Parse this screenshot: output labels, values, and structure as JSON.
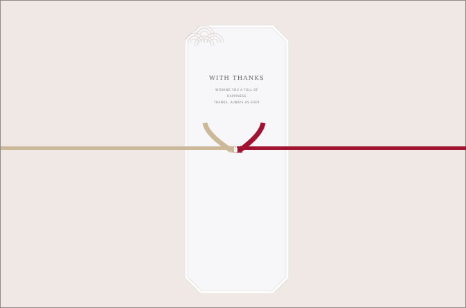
{
  "card": {
    "title": "WITH THANKS",
    "message_lines": [
      "WISHING YOU A FULL OF",
      "HAPPINESS",
      "THANKS, ALWAYS AS EVER"
    ]
  },
  "cords": {
    "left_color": "#cbb99a",
    "right_color": "#a01432"
  },
  "icons": {
    "emblem": "seigaiha-wave-icon"
  }
}
